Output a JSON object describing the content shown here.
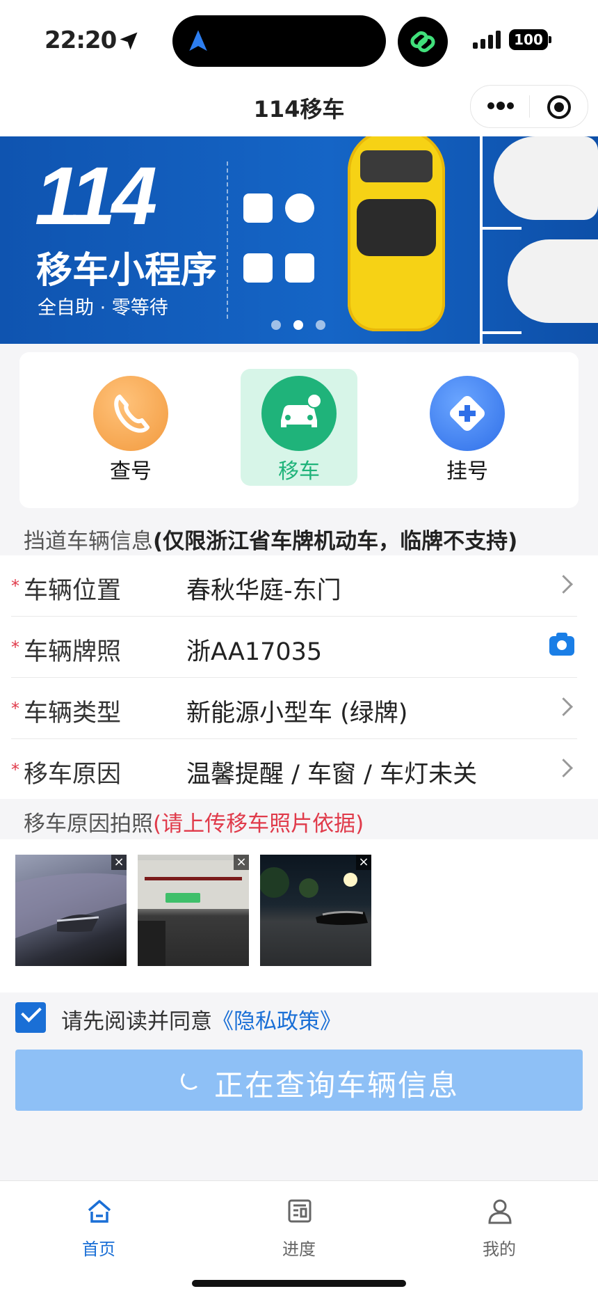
{
  "status_bar": {
    "time": "22:20",
    "battery": "100"
  },
  "header": {
    "title": "114移车"
  },
  "banner": {
    "number": "114",
    "title": "移车小程序",
    "subtitle": "全自助 · 零等待",
    "slide_count": 3,
    "active_slide": 2
  },
  "functions": [
    {
      "label": "查号",
      "icon": "phone-icon",
      "color": "#f4a24a"
    },
    {
      "label": "移车",
      "icon": "car-icon",
      "color": "#1fb37a"
    },
    {
      "label": "挂号",
      "icon": "plus-diamond-icon",
      "color": "#3a7ff0"
    }
  ],
  "vehicle_section": {
    "title": "挡道车辆信息",
    "note": "(仅限浙江省车牌机动车，临牌不支持)"
  },
  "form_rows": [
    {
      "label": "车辆位置",
      "value": "春秋华庭-东门",
      "action": "chevron-right-icon"
    },
    {
      "label": "车辆牌照",
      "value": "浙AA17035",
      "action": "camera-icon"
    },
    {
      "label": "车辆类型",
      "value": "新能源小型车 (绿牌)",
      "action": "chevron-right-icon"
    },
    {
      "label": "移车原因",
      "value": "温馨提醒 / 车窗 / 车灯未关",
      "action": "chevron-right-icon"
    }
  ],
  "photo_section": {
    "title": "移车原因拍照",
    "note": "(请上传移车照片依据)",
    "close_symbol": "×"
  },
  "agreement": {
    "checked": true,
    "text": "请先阅读并同意",
    "link": "《隐私政策》"
  },
  "submit_button": {
    "label": "正在查询车辆信息"
  },
  "tabbar": {
    "items": [
      {
        "label": "首页",
        "icon": "home-icon"
      },
      {
        "label": "进度",
        "icon": "news-icon"
      },
      {
        "label": "我的",
        "icon": "person-icon"
      }
    ],
    "active_index": 0
  },
  "colors": {
    "accent": "#1a6fd6",
    "required": "#e03a4a",
    "button": "#8ec0f6",
    "active_func_bg": "#d7f5e8"
  }
}
